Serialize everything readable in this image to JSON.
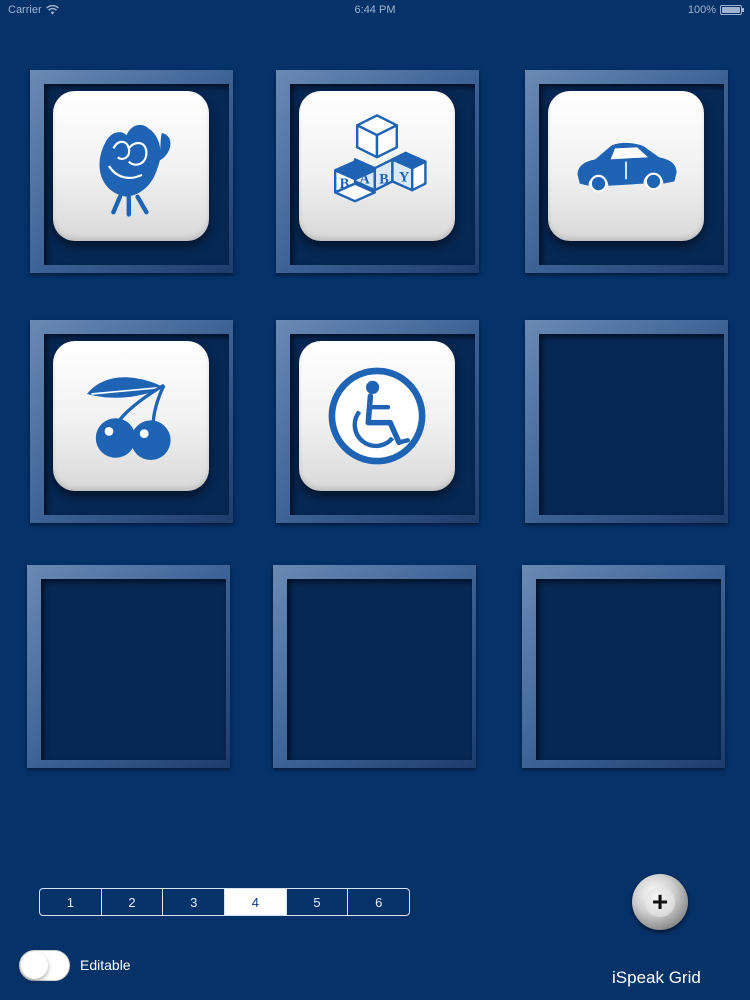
{
  "status_bar": {
    "carrier": "Carrier",
    "time": "6:44 PM",
    "battery": "100%"
  },
  "grid": {
    "cells": [
      {
        "icon": "rose-icon"
      },
      {
        "icon": "baby-blocks-icon",
        "blocks_text": [
          "B",
          "A",
          "B",
          "Y"
        ]
      },
      {
        "icon": "car-icon"
      },
      {
        "icon": "cherries-icon"
      },
      {
        "icon": "wheelchair-icon"
      },
      {
        "icon": null
      },
      {
        "icon": null
      },
      {
        "icon": null
      },
      {
        "icon": null
      }
    ]
  },
  "pager": {
    "pages": [
      "1",
      "2",
      "3",
      "4",
      "5",
      "6"
    ],
    "selected": "4"
  },
  "add_button": {
    "label": "+"
  },
  "editable_toggle": {
    "label": "Editable",
    "on": false
  },
  "brand": "iSpeak Grid",
  "colors": {
    "background": "#06326a",
    "icon_blue": "#1e63b4",
    "tile_white": "#f5f5f5"
  }
}
